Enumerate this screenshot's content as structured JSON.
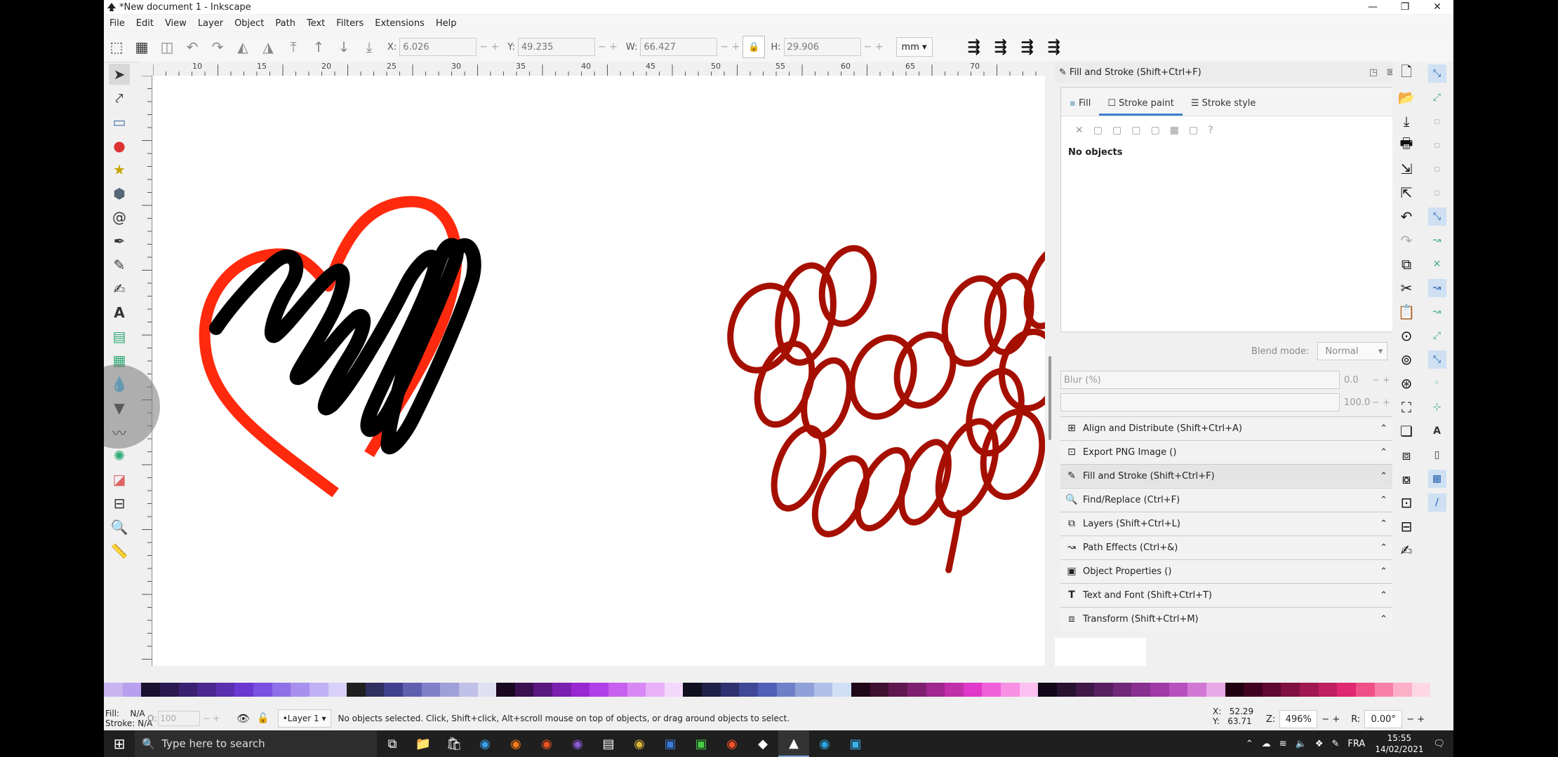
{
  "window": {
    "title": "*New document 1 - Inkscape",
    "controls": [
      "—",
      "❐",
      "✕"
    ]
  },
  "menu": [
    "File",
    "Edit",
    "View",
    "Layer",
    "Object",
    "Path",
    "Text",
    "Filters",
    "Extensions",
    "Help"
  ],
  "toolbar": {
    "x_label": "X:",
    "x_value": "6.026",
    "y_label": "Y:",
    "y_value": "49.235",
    "w_label": "W:",
    "w_value": "66.427",
    "h_label": "H:",
    "h_value": "29.906",
    "unit": "mm"
  },
  "ruler": {
    "top_ticks": [
      "10",
      "15",
      "20",
      "25",
      "30",
      "35",
      "40",
      "45",
      "50",
      "55",
      "60",
      "65",
      "70"
    ]
  },
  "dock": {
    "title": "Fill and Stroke (Shift+Ctrl+F)",
    "tabs": [
      "Fill",
      "Stroke paint",
      "Stroke style"
    ],
    "paint_buttons": [
      "✕",
      "▢",
      "▢",
      "▢",
      "▢",
      "▦",
      "▢",
      "?"
    ],
    "no_objects": "No objects",
    "blend_label": "Blend mode:",
    "blend_value": "Normal",
    "blur_label": "Blur (%)",
    "blur_value": "0.0",
    "opacity_value": "100.0",
    "dialogs": [
      {
        "label": "Align and Distribute (Shift+Ctrl+A)",
        "icon": "align-icon"
      },
      {
        "label": "Export PNG Image ()",
        "icon": "export-icon"
      },
      {
        "label": "Fill and Stroke (Shift+Ctrl+F)",
        "icon": "fill-stroke-icon"
      },
      {
        "label": "Find/Replace (Ctrl+F)",
        "icon": "find-icon"
      },
      {
        "label": "Layers (Shift+Ctrl+L)",
        "icon": "layers-icon"
      },
      {
        "label": "Path Effects (Ctrl+&)",
        "icon": "path-effects-icon"
      },
      {
        "label": "Object Properties ()",
        "icon": "object-properties-icon"
      },
      {
        "label": "Text and Font (Shift+Ctrl+T)",
        "icon": "text-font-icon"
      },
      {
        "label": "Transform (Shift+Ctrl+M)",
        "icon": "transform-icon"
      }
    ]
  },
  "status": {
    "fill_label": "Fill:",
    "fill_value": "N/A",
    "stroke_label": "Stroke:",
    "stroke_value": "N/A",
    "opacity_label": "O:",
    "opacity_value": "100",
    "layer": "•Layer 1",
    "message": "No objects selected. Click, Shift+click, Alt+scroll mouse on top of objects, or drag around objects to select.",
    "x_label": "X:",
    "x_value": "52.29",
    "y_label": "Y:",
    "y_value": "63.71",
    "zoom_label": "Z:",
    "zoom_value": "496%",
    "rot_label": "R:",
    "rot_value": "0.00°"
  },
  "taskbar": {
    "search_placeholder": "Type here to search",
    "lang": "FRA",
    "time": "15:55",
    "date": "14/02/2021"
  },
  "colors": {
    "heart_red": "#ff2a0e",
    "scribble_black": "#000000",
    "scribble_darkred": "#a50f00",
    "accent": "#3d7fd1"
  },
  "palette": [
    "#c8b4f0",
    "#b9a0ee",
    "#1a1030",
    "#2a1850",
    "#3a2070",
    "#4a2890",
    "#5a30b0",
    "#6a38d0",
    "#7a50e0",
    "#9070e8",
    "#a890ee",
    "#c0b0f4",
    "#d8d0f8",
    "#202020",
    "#303060",
    "#404090",
    "#6060b0",
    "#8080c8",
    "#a0a0d8",
    "#c0c0e8",
    "#e0e0f4",
    "#1a0820",
    "#3a1050",
    "#5a1880",
    "#7a20b0",
    "#9a28d0",
    "#b040e8",
    "#c860f0",
    "#d888f4",
    "#e8b0f8",
    "#f4d8fc",
    "#101020",
    "#202048",
    "#303070",
    "#404898",
    "#5060b8",
    "#7080c8",
    "#90a0d8",
    "#b0c0e8",
    "#d0e0f4",
    "#200818",
    "#401030",
    "#601850",
    "#802070",
    "#a02890",
    "#c030a8",
    "#e038c8",
    "#f060d8",
    "#f890e4",
    "#fcc0f0",
    "#100818",
    "#281030",
    "#401848",
    "#582060",
    "#702878",
    "#883090",
    "#a038a8",
    "#b850c0",
    "#d078d4",
    "#e8a8e8",
    "#200010",
    "#400020",
    "#600830",
    "#801040",
    "#a01850",
    "#c02060",
    "#e02870",
    "#f05088",
    "#f880a8",
    "#fcb0c8",
    "#fdd8e4"
  ]
}
